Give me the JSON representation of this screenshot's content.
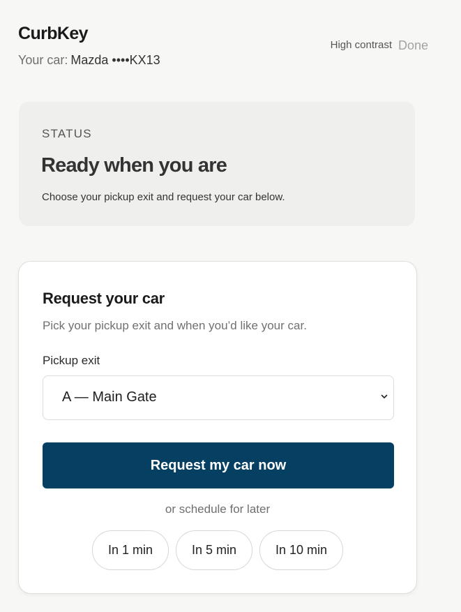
{
  "header": {
    "app_title": "CurbKey",
    "car_label": "Your car:",
    "car_value": "Mazda ••••KX13",
    "high_contrast": "High contrast",
    "done": "Done"
  },
  "status": {
    "label": "STATUS",
    "title": "Ready when you are",
    "hint": "Choose your pickup exit and request your car below."
  },
  "request": {
    "title": "Request your car",
    "subtitle": "Pick your pickup exit and when you’d like your car.",
    "exit_label": "Pickup exit",
    "exit_value": "A — Main Gate",
    "primary_button": "Request my car now",
    "schedule_text": "or schedule for later",
    "schedule_options": [
      "In 1 min",
      "In 5 min",
      "In 10 min"
    ]
  },
  "colors": {
    "primary": "#053f62",
    "background": "#f7f7f5",
    "status_card": "#efefed"
  },
  "icons": {
    "select_chevron": "chevron-down-icon"
  }
}
